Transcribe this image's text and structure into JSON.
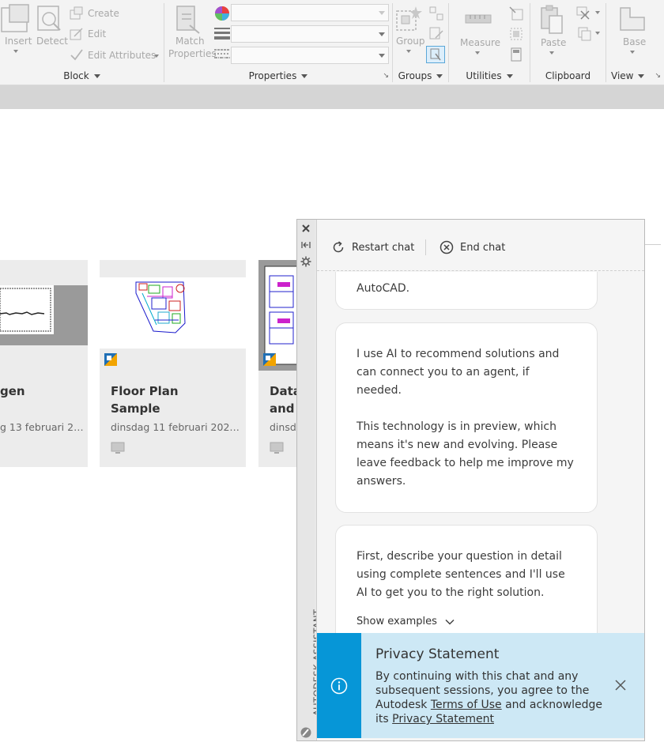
{
  "ribbon": {
    "block": {
      "title": "Block",
      "insert": "Insert",
      "detect": "Detect",
      "create": "Create",
      "edit": "Edit",
      "edit_attributes": "Edit Attributes"
    },
    "properties": {
      "title": "Properties",
      "match_properties_1": "Match",
      "match_properties_2": "Properties"
    },
    "groups": {
      "title": "Groups",
      "group": "Group"
    },
    "utilities": {
      "title": "Utilities",
      "measure": "Measure"
    },
    "clipboard": {
      "title": "Clipboard",
      "paste": "Paste"
    },
    "view": {
      "title": "View",
      "base": "Base"
    }
  },
  "cards": [
    {
      "title_1": "gen",
      "title_2": "",
      "date": "g 13 februari 2…"
    },
    {
      "title_1": "Floor Plan",
      "title_2": "Sample",
      "date": "dinsdag 11 februari 202…"
    },
    {
      "title_1": "Data",
      "title_2": "and l",
      "date": "dinsd"
    }
  ],
  "assistant": {
    "rail_label": "AUTODESK ASSISTANT",
    "restart_chat": "Restart chat",
    "end_chat": "End chat",
    "messages": [
      {
        "text": "AutoCAD."
      },
      {
        "p1": "I use AI to recommend solutions and can connect you to an agent, if needed.",
        "p2": "This technology is in preview, which means it's new and evolving. Please leave feedback to help me improve my answers."
      },
      {
        "p1": "First, describe your question in detail using complete sentences and I'll use AI to get you to the right solution.",
        "show_examples": "Show examples"
      }
    ],
    "privacy": {
      "title": "Privacy Statement",
      "text_1": "By continuing with this chat and any subsequent sessions, you agree to the Autodesk",
      "terms_link": "Terms of Use",
      "text_2": "and acknowledge its",
      "privacy_link": "Privacy Statement"
    }
  },
  "colors": {
    "accent": "#0696d7",
    "privacy_bg": "#cde8f5"
  }
}
